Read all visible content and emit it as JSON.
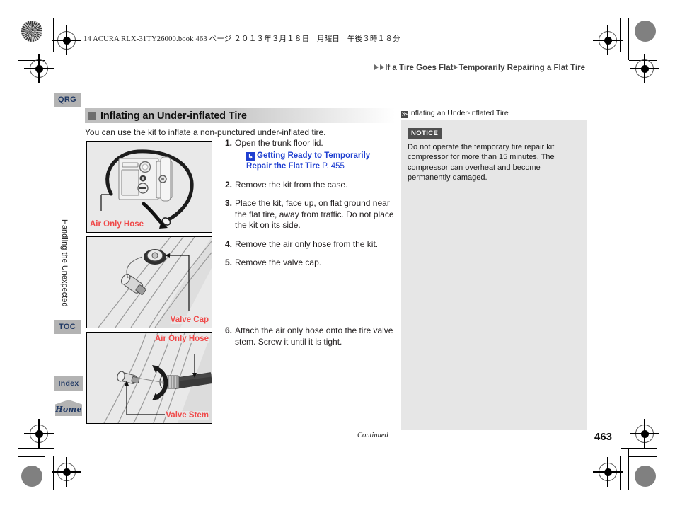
{
  "book_header": "14 ACURA RLX-31TY26000.book  463 ページ  ２０１３年３月１８日　月曜日　午後３時１８分",
  "breadcrumb": {
    "item1": "If a Tire Goes Flat",
    "item2": "Temporarily Repairing a Flat Tire"
  },
  "sidebar": {
    "qrg": "QRG",
    "toc": "TOC",
    "index": "Index",
    "home": "Home",
    "chapter": "Handling the Unexpected"
  },
  "section": {
    "title": "Inflating an Under-inflated Tire",
    "intro": "You can use the kit to inflate a non-punctured under-inflated tire."
  },
  "steps": [
    {
      "num": "1.",
      "text": "Open the trunk floor lid.",
      "xref": "Getting Ready to Temporarily Repair the Flat Tire",
      "xref_page": "P. 455",
      "xref_icon": "↳"
    },
    {
      "num": "2.",
      "text": "Remove the kit from the case."
    },
    {
      "num": "3.",
      "text": "Place the kit, face up, on flat ground near the flat tire, away from traffic. Do not place the kit on its side."
    },
    {
      "num": "4.",
      "text": "Remove the air only hose from the kit."
    },
    {
      "num": "5.",
      "text": "Remove the valve cap."
    },
    {
      "num": "6.",
      "text": "Attach the air only hose onto the tire valve stem. Screw it until it is tight."
    }
  ],
  "figures": [
    {
      "caption": "Air Only Hose"
    },
    {
      "caption": "Valve Cap"
    },
    {
      "caption_a": "Air Only Hose",
      "caption_b": "Valve Stem"
    }
  ],
  "info": {
    "heading": "Inflating an Under-inflated Tire",
    "heading_icon": "≫",
    "notice_label": "NOTICE",
    "notice_text": "Do not operate the temporary tire repair kit compressor for more than 15 minutes. The compressor can overheat and become permanently damaged."
  },
  "footer": {
    "continued": "Continued",
    "page_number": "463"
  },
  "colors": {
    "accent_blue": "#1f3fd0",
    "caption_red": "#ef4a4a",
    "tab_gray": "#b3b3b3",
    "panel_gray": "#e6e6e6",
    "nav_navy": "#1f3864"
  }
}
